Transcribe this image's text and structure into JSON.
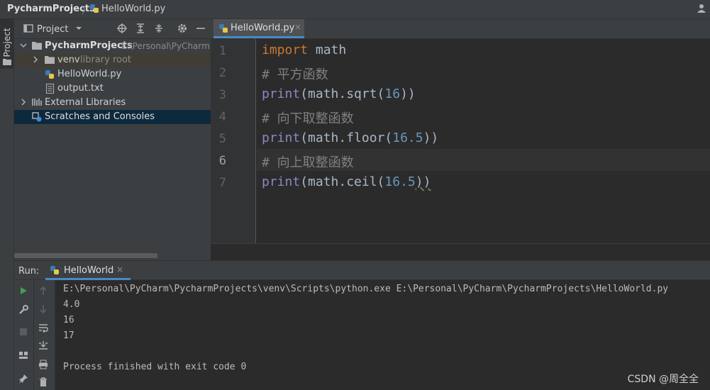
{
  "titlebar": {
    "project": "PycharmProjects",
    "separator": "〉",
    "file": "HelloWorld.py"
  },
  "left_strip": {
    "tab_label": "Project"
  },
  "project_panel": {
    "view_label": "Project",
    "tree": {
      "root": {
        "name": "PycharmProjects",
        "path": "E:\\Personal\\PyCharm"
      },
      "venv": {
        "name": "venv",
        "hint": "library root"
      },
      "hello": {
        "name": "HelloWorld.py"
      },
      "output": {
        "name": "output.txt"
      },
      "extlib": {
        "name": "External Libraries"
      },
      "scratch": {
        "name": "Scratches and Consoles"
      }
    }
  },
  "editor": {
    "tab_label": "HelloWorld.py",
    "close_glyph": "×",
    "line_numbers": [
      "1",
      "2",
      "3",
      "4",
      "5",
      "6",
      "7"
    ],
    "current_line": 6,
    "code": {
      "l1": {
        "kw": "import",
        "rest": " math"
      },
      "l2": {
        "comment": "# 平方函数"
      },
      "l3": {
        "fn": "print",
        "a": "(math.sqrt(",
        "num": "16",
        "b": "))"
      },
      "l4": {
        "comment": "# 向下取整函数"
      },
      "l5": {
        "fn": "print",
        "a": "(math.floor(",
        "num": "16.5",
        "b": "))"
      },
      "l6": {
        "comment": "# 向上取整函数"
      },
      "l7": {
        "fn": "print",
        "a": "(math.ceil(",
        "num": "16.5",
        "b": "))"
      }
    }
  },
  "run": {
    "label": "Run:",
    "tab_label": "HelloWorld",
    "close_glyph": "×",
    "console": [
      "E:\\Personal\\PyCharm\\PycharmProjects\\venv\\Scripts\\python.exe E:\\Personal\\PyCharm\\PycharmProjects\\HelloWorld.py",
      "4.0",
      "16",
      "17",
      "",
      "Process finished with exit code 0"
    ]
  },
  "watermark": "CSDN @周全全",
  "colors": {
    "keyword": "#cc7832",
    "builtin": "#8888c6",
    "number": "#6897bb",
    "comment": "#808080",
    "run_green": "#499c54",
    "selection": "#0d293e"
  }
}
